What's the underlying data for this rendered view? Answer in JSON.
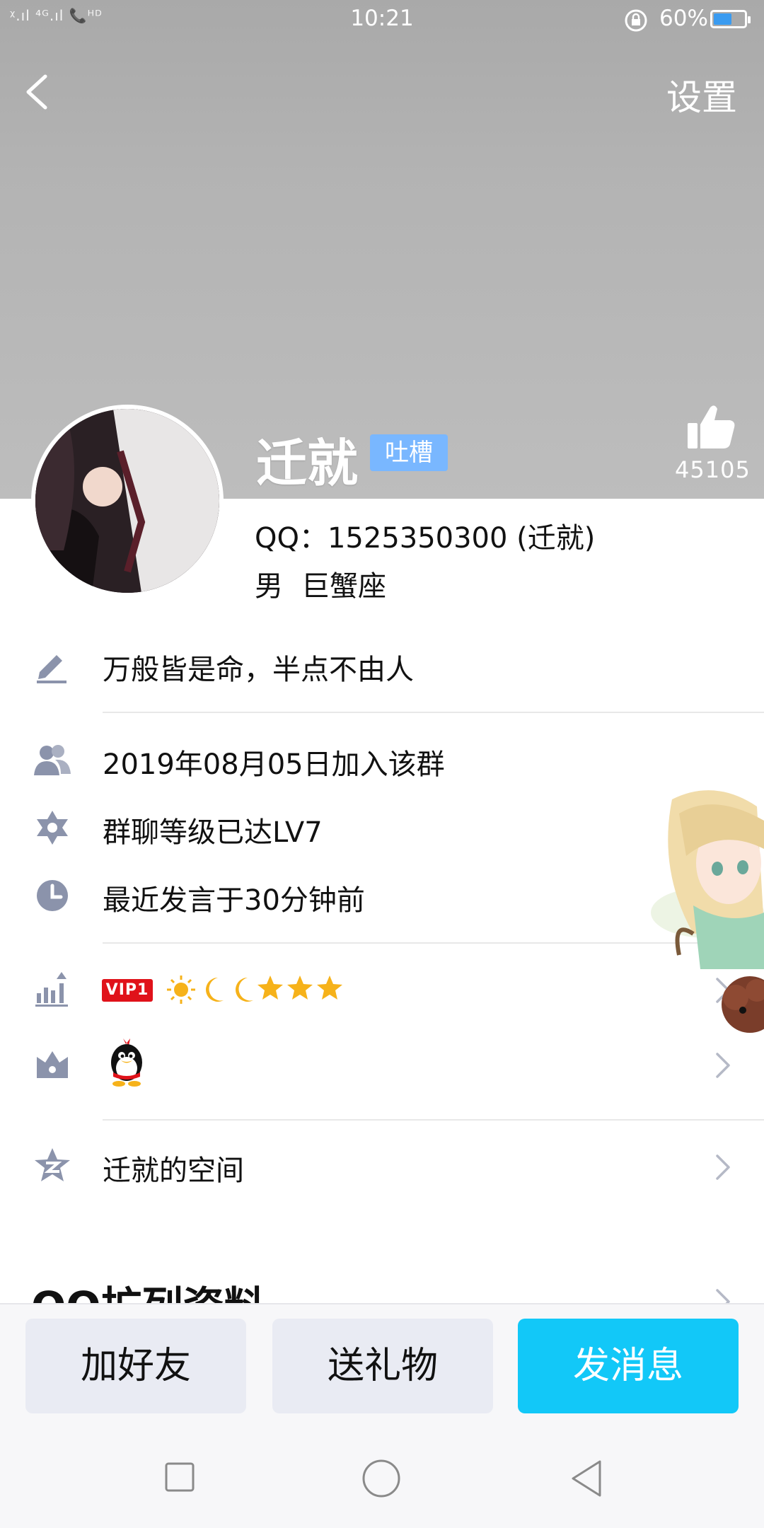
{
  "status_bar": {
    "signal_text": "ᵡ.ıl ⁴ᴳ.ıl 📞ᴴᴰ",
    "time": "10:21",
    "battery_percent_text": "60%",
    "battery_level": 0.6
  },
  "header": {
    "back_icon": "chevron-left-icon",
    "settings_label": "设置"
  },
  "profile": {
    "nickname": "迁就",
    "tag": "吐槽",
    "like_count": "45105",
    "qq_line": "QQ：1525350300 (迁就)",
    "gender": "男",
    "zodiac": "巨蟹座"
  },
  "rows": {
    "signature": "万般皆是命，半点不由人",
    "join_date": "2019年08月05日加入该群",
    "group_level": "群聊等级已达LV7",
    "last_active": "最近发言于30分钟前",
    "vip_badge": "VIP1",
    "zone": "迁就的空间"
  },
  "section": {
    "ext_title": "QQ扩列资料"
  },
  "actions": {
    "add_friend": "加好友",
    "send_gift": "送礼物",
    "send_message": "发消息"
  },
  "colors": {
    "accent": "#12c8f8",
    "tag": "#79b7ff",
    "vip": "#e0121a",
    "icon": "#8b93ab"
  }
}
